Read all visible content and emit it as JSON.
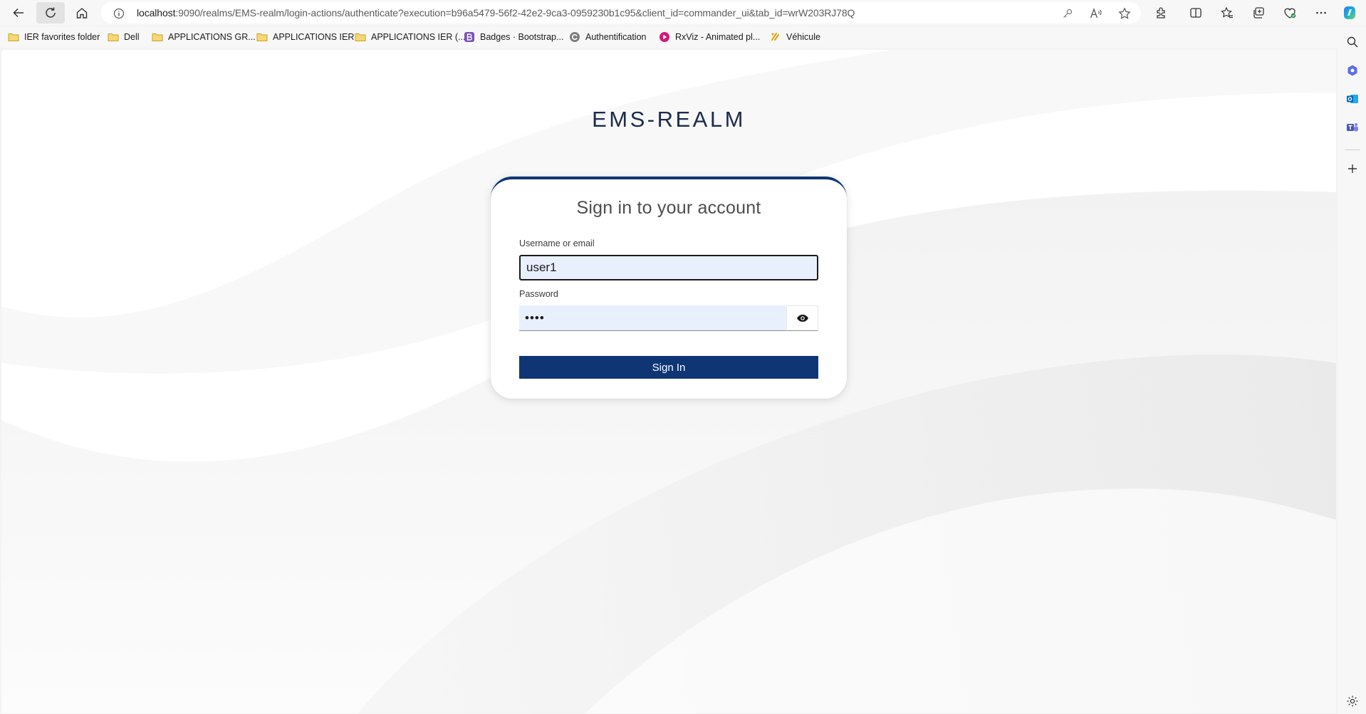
{
  "browser": {
    "address": {
      "host": "localhost",
      "rest": ":9090/realms/EMS-realm/login-actions/authenticate?execution=b96a5479-56f2-42e2-9ca3-0959230b1c95&client_id=commander_ui&tab_id=wrW203RJ78Q"
    },
    "bookmarks": [
      {
        "label": "IER favorites folder",
        "icon": "folder-icon"
      },
      {
        "label": "Dell",
        "icon": "folder-icon"
      },
      {
        "label": "APPLICATIONS GR...",
        "icon": "folder-icon"
      },
      {
        "label": "APPLICATIONS IER",
        "icon": "folder-icon"
      },
      {
        "label": "APPLICATIONS IER (...",
        "icon": "folder-icon"
      },
      {
        "label": "Badges · Bootstrap...",
        "icon": "bootstrap-icon"
      },
      {
        "label": "Authentification",
        "icon": "site-icon"
      },
      {
        "label": "RxViz - Animated pl...",
        "icon": "play-icon"
      },
      {
        "label": "Véhicule",
        "icon": "car-icon"
      }
    ]
  },
  "page": {
    "realm_title": "EMS-REALM",
    "card_title": "Sign in to your account",
    "username": {
      "label": "Username or email",
      "value": "user1"
    },
    "password": {
      "label": "Password",
      "value": "user"
    },
    "signin_label": "Sign In"
  },
  "colors": {
    "primary": "#0f3575",
    "input_fill": "#e8f0fe",
    "title": "#1c2b4d"
  }
}
